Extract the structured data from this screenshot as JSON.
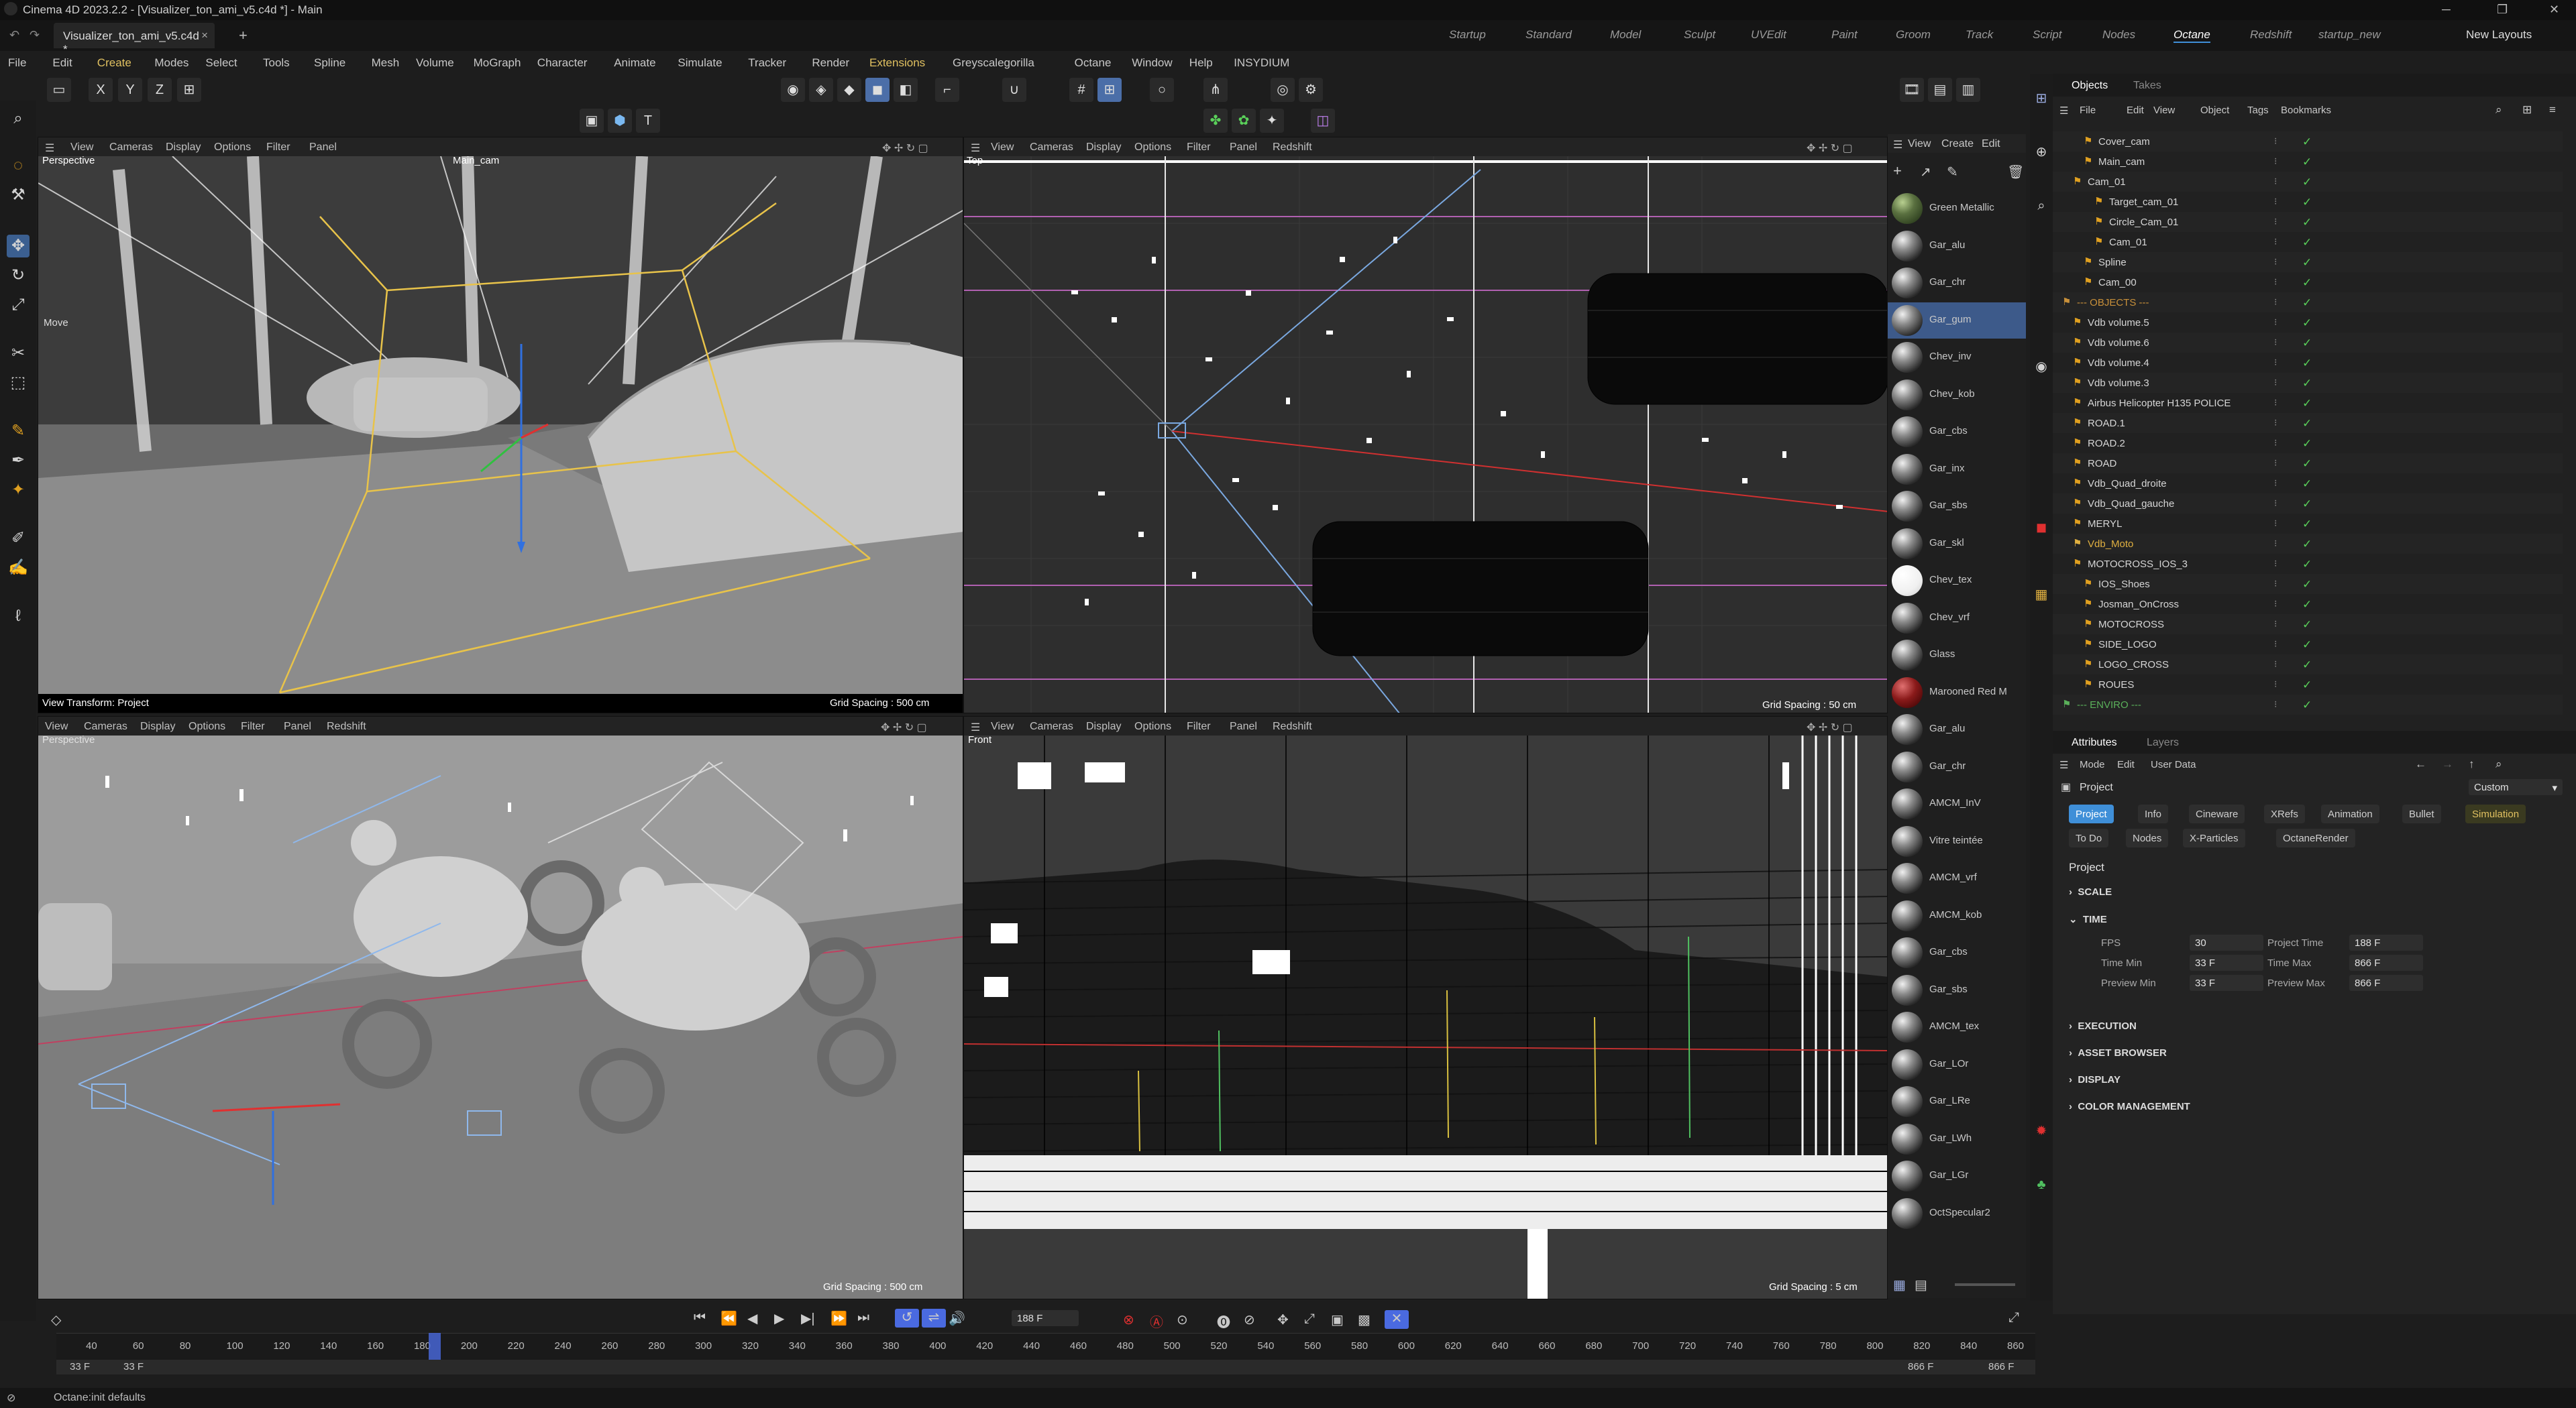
{
  "titlebar": {
    "title": "Cinema 4D 2023.2.2 - [Visualizer_ton_ami_v5.c4d *] - Main"
  },
  "doc_tab": {
    "label": "Visualizer_ton_ami_v5.c4d *"
  },
  "layouts": [
    "Startup",
    "Standard",
    "Model",
    "Sculpt",
    "UVEdit",
    "Paint",
    "Groom",
    "Track",
    "Script",
    "Nodes",
    "Octane",
    "Redshift",
    "startup_new"
  ],
  "active_layout": "Octane",
  "new_layouts_label": "New Layouts",
  "menu": [
    "File",
    "Edit",
    "Create",
    "Modes",
    "Select",
    "Tools",
    "Spline",
    "Mesh",
    "Volume",
    "MoGraph",
    "Character",
    "Animate",
    "Simulate",
    "Tracker",
    "Render",
    "Extensions",
    "Greyscalegorilla",
    "Octane",
    "Window",
    "Help",
    "INSYDIUM"
  ],
  "viewports": [
    {
      "menu": [
        "View",
        "Cameras",
        "Display",
        "Options",
        "Filter",
        "Panel"
      ],
      "label": "Perspective",
      "camera": "Main_cam",
      "footer_left": "View Transform: Project",
      "footer_right": "Grid Spacing : 500 cm",
      "move_label": "Move"
    },
    {
      "menu": [
        "View",
        "Cameras",
        "Display",
        "Options",
        "Filter",
        "Panel",
        "Redshift"
      ],
      "label": "Top",
      "footer_right": "Grid Spacing : 50 cm"
    },
    {
      "menu": [
        "View",
        "Cameras",
        "Display",
        "Options",
        "Filter",
        "Panel",
        "Redshift"
      ],
      "label": "Perspective",
      "footer_right": "Grid Spacing : 500 cm"
    },
    {
      "menu": [
        "View",
        "Cameras",
        "Display",
        "Options",
        "Filter",
        "Panel",
        "Redshift"
      ],
      "label": "Front",
      "footer_right": "Grid Spacing : 5 cm"
    }
  ],
  "materials_menu": [
    "View",
    "Create",
    "Edit"
  ],
  "materials": [
    "Green Metallic",
    "Gar_alu",
    "Gar_chr",
    "Gar_gum",
    "Chev_inv",
    "Chev_kob",
    "Gar_cbs",
    "Gar_inx",
    "Gar_sbs",
    "Gar_skl",
    "Chev_tex",
    "Chev_vrf",
    "Glass",
    "Marooned Red M",
    "Gar_alu",
    "Gar_chr",
    "AMCM_InV",
    "Vitre teintée",
    "AMCM_vrf",
    "AMCM_kob",
    "Gar_cbs",
    "Gar_sbs",
    "AMCM_tex",
    "Gar_LOr",
    "Gar_LRe",
    "Gar_LWh",
    "Gar_LGr",
    "OctSpecular2"
  ],
  "object_tabs": [
    "Objects",
    "Takes"
  ],
  "object_menu": [
    "File",
    "Edit",
    "View",
    "Object",
    "Tags",
    "Bookmarks"
  ],
  "objects": [
    {
      "name": "Cover_cam",
      "indent": 2
    },
    {
      "name": "Main_cam",
      "indent": 2
    },
    {
      "name": "Cam_01",
      "indent": 1
    },
    {
      "name": "Target_cam_01",
      "indent": 3
    },
    {
      "name": "Circle_Cam_01",
      "indent": 3
    },
    {
      "name": "Cam_01",
      "indent": 3
    },
    {
      "name": "Spline",
      "indent": 2
    },
    {
      "name": "Cam_00",
      "indent": 2
    },
    {
      "name": "--- OBJECTS ---",
      "indent": 0,
      "color": "#c8903a"
    },
    {
      "name": "Vdb volume.5",
      "indent": 1
    },
    {
      "name": "Vdb volume.6",
      "indent": 1
    },
    {
      "name": "Vdb volume.4",
      "indent": 1
    },
    {
      "name": "Vdb volume.3",
      "indent": 1
    },
    {
      "name": "Airbus Helicopter H135 POLICE",
      "indent": 1
    },
    {
      "name": "ROAD.1",
      "indent": 1
    },
    {
      "name": "ROAD.2",
      "indent": 1
    },
    {
      "name": "ROAD",
      "indent": 1
    },
    {
      "name": "Vdb_Quad_droite",
      "indent": 1
    },
    {
      "name": "Vdb_Quad_gauche",
      "indent": 1
    },
    {
      "name": "MERYL",
      "indent": 1
    },
    {
      "name": "Vdb_Moto",
      "indent": 1,
      "color": "#e0b040"
    },
    {
      "name": "MOTOCROSS_IOS_3",
      "indent": 1
    },
    {
      "name": "IOS_Shoes",
      "indent": 2
    },
    {
      "name": "Josman_OnCross",
      "indent": 2
    },
    {
      "name": "MOTOCROSS",
      "indent": 2
    },
    {
      "name": "SIDE_LOGO",
      "indent": 2
    },
    {
      "name": "LOGO_CROSS",
      "indent": 2
    },
    {
      "name": "ROUES",
      "indent": 2
    },
    {
      "name": "--- ENVIRO ---",
      "indent": 0,
      "color": "#5ab05a"
    }
  ],
  "attr_tabs": [
    "Attributes",
    "Layers"
  ],
  "attr_menu": [
    "Mode",
    "Edit",
    "User Data"
  ],
  "attr_title": "Project",
  "attr_dropdown": "Custom",
  "attr_pills_row1": [
    "Project",
    "Info",
    "Cineware",
    "XRefs",
    "Animation",
    "Bullet",
    "Simulation"
  ],
  "attr_pills_row2": [
    "To Do",
    "Nodes",
    "X-Particles",
    "OctaneRender"
  ],
  "attr_heading": "Project",
  "sections": {
    "scale": "SCALE",
    "time": "TIME",
    "execution": "EXECUTION",
    "asset_browser": "ASSET BROWSER",
    "display": "DISPLAY",
    "color_mgmt": "COLOR MANAGEMENT"
  },
  "time_fields": {
    "fps_label": "FPS",
    "fps": "30",
    "project_time_label": "Project Time",
    "project_time": "188 F",
    "time_min_label": "Time Min",
    "time_min": "33 F",
    "time_max_label": "Time Max",
    "time_max": "866 F",
    "preview_min_label": "Preview Min",
    "preview_min": "33 F",
    "preview_max_label": "Preview Max",
    "preview_max": "866 F"
  },
  "timeline": {
    "current_frame": "188 F",
    "ticks": [
      "40",
      "60",
      "80",
      "100",
      "120",
      "140",
      "160",
      "180",
      "200",
      "220",
      "240",
      "260",
      "280",
      "300",
      "320",
      "340",
      "360",
      "380",
      "400",
      "420",
      "440",
      "460",
      "480",
      "500",
      "520",
      "540",
      "560",
      "580",
      "600",
      "620",
      "640",
      "660",
      "680",
      "700",
      "720",
      "740",
      "760",
      "780",
      "800",
      "820",
      "840",
      "860"
    ],
    "start_left": "33 F",
    "start_right": "33 F",
    "end_left": "866 F",
    "end_right": "866 F",
    "playhead_frame": 188
  },
  "status": "Octane:init defaults",
  "colors": {
    "accent": "#3f8fd8",
    "playhead": "#4a6ae0",
    "selection_orange": "#e07b2a"
  }
}
